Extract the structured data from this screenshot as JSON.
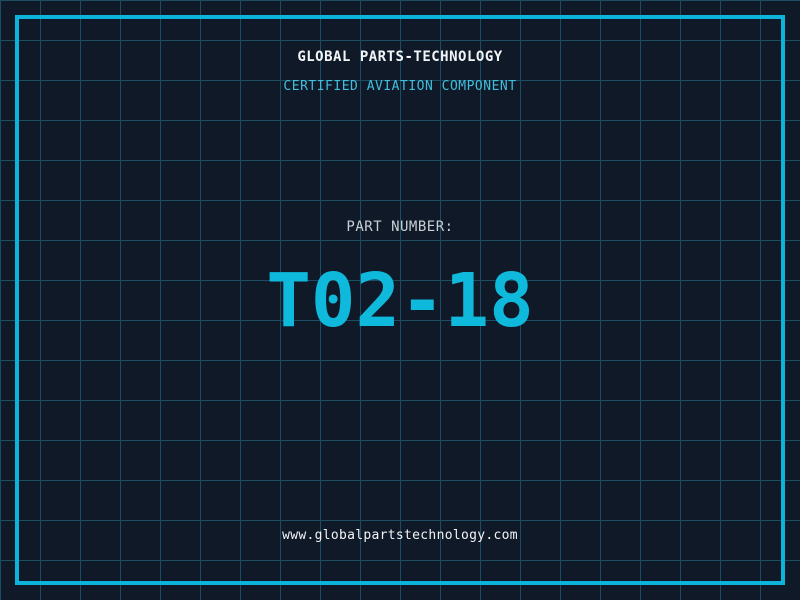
{
  "theme": {
    "background": "#0f1928",
    "grid_line": "#1b4e62",
    "frame": "#0cb4dc",
    "part_number_cyan": "#0fb9db",
    "subtitle_cyan": "#41bedd",
    "label_gray": "#c9cfd6",
    "text_white": "#f2f5f7"
  },
  "header": {
    "title": "GLOBAL PARTS-TECHNOLOGY",
    "subtitle": "CERTIFIED AVIATION COMPONENT"
  },
  "part": {
    "label": "PART NUMBER:",
    "number": "T02-18"
  },
  "footer": {
    "website": "www.globalpartstechnology.com"
  }
}
